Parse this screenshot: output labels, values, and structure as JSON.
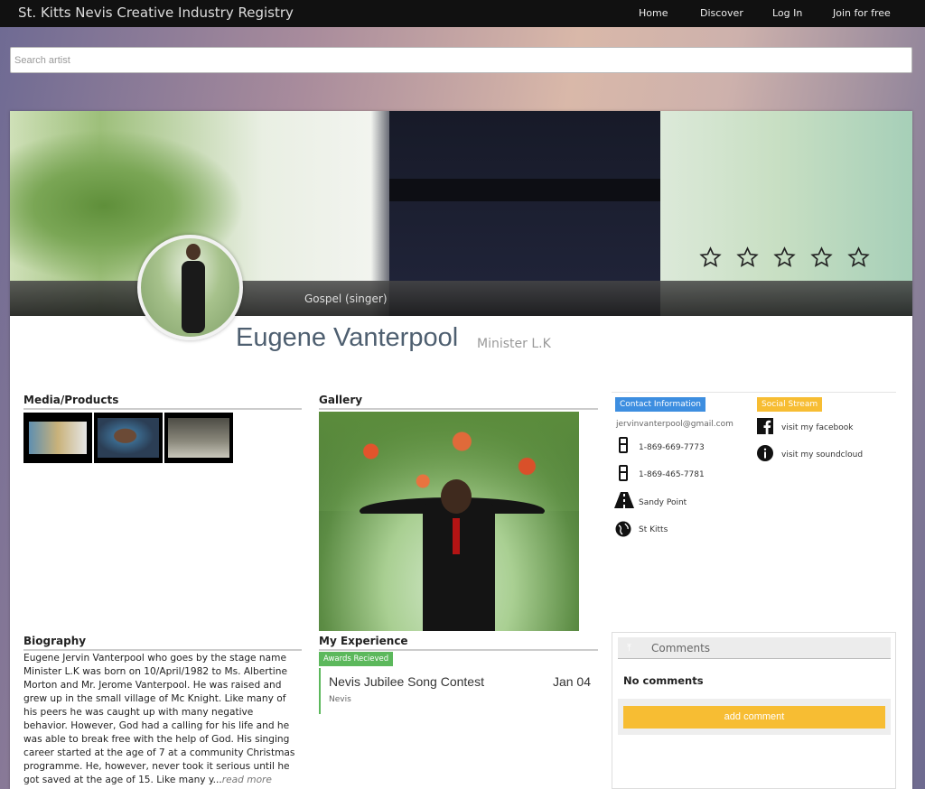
{
  "header": {
    "brand": "St. Kitts Nevis Creative Industry Registry",
    "nav": [
      "Home",
      "Discover",
      "Log In",
      "Join for free"
    ]
  },
  "search": {
    "placeholder": "Search artist"
  },
  "profile": {
    "genre": "Gospel (singer)",
    "name": "Eugene Vanterpool",
    "alias": "Minister L.K",
    "rating": {
      "stars_filled": 0,
      "stars_total": 5
    }
  },
  "sections": {
    "media": "Media/Products",
    "gallery": "Gallery",
    "biography": "Biography",
    "experience": "My Experience"
  },
  "contact": {
    "tag": "Contact Information",
    "email": "jervinvanterpool@gmail.com",
    "phone1": "1-869-669-7773",
    "phone2": "1-869-465-7781",
    "road": "Sandy Point",
    "place": "St Kitts"
  },
  "social": {
    "tag": "Social Stream",
    "facebook": "visit my facebook",
    "soundcloud": "visit my soundcloud"
  },
  "biography": {
    "text": "Eugene Jervin Vanterpool who goes by the stage name Minister L.K was born on 10/April/1982 to Ms. Albertine Morton and Mr. Jerome Vanterpool. He was raised and grew up in the small village of Mc Knight. Like many of his peers he was caught up with many negative behavior. However, God had a calling for his life and he was able to break free with the help of God. His singing career started at the age of 7 at a community Christmas programme. He, however, never took it serious until he got saved at the age of 15. Like many y...",
    "read_more": "read more"
  },
  "experience": {
    "tag": "Awards Recieved",
    "title": "Nevis Jubilee Song Contest",
    "date": "Jan 04",
    "location": "Nevis"
  },
  "comments": {
    "label": "Comments",
    "empty": "No comments",
    "add": "add comment"
  },
  "colors": {
    "contact_tag": "#3d8ee0",
    "social_tag": "#f7bd33",
    "award_tag": "#5cb85c",
    "add_button": "#f7bd33"
  }
}
